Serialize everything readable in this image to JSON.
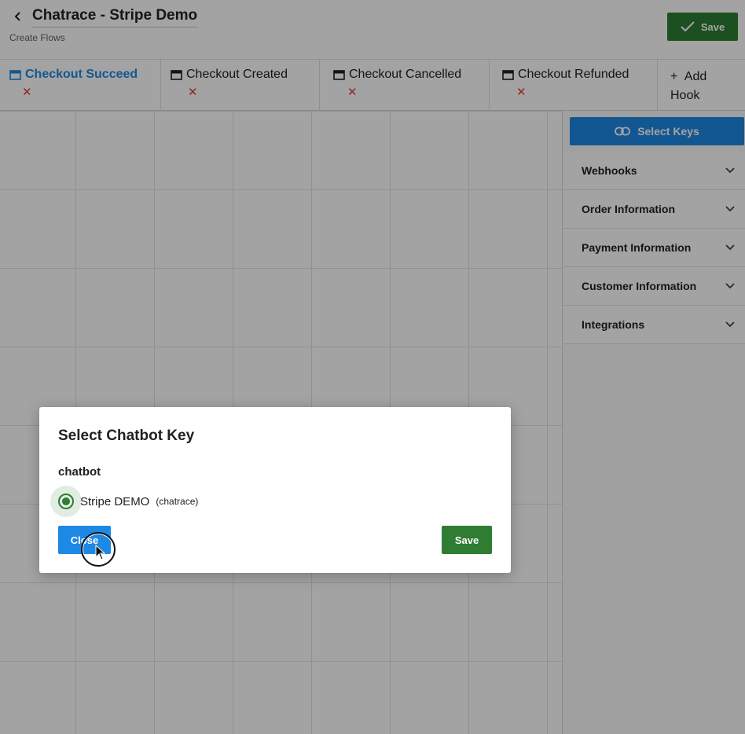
{
  "header": {
    "title": "Chatrace - Stripe Demo",
    "subtitle": "Create Flows",
    "save_label": "Save",
    "back_icon": "chevron-left-icon",
    "save_icon": "check-icon"
  },
  "tabs": [
    {
      "label": "Checkout Succeed",
      "active": true,
      "close": "✕"
    },
    {
      "label": "Checkout Created",
      "active": false,
      "close": "✕"
    },
    {
      "label": "Checkout Cancelled",
      "active": false,
      "close": "✕"
    },
    {
      "label": "Checkout Refunded",
      "active": false,
      "close": "✕"
    }
  ],
  "add_hook": {
    "plus": "+",
    "line1": "Add",
    "line2": "Hook"
  },
  "panel": {
    "select_keys_label": "Select Keys",
    "select_keys_icon": "link-icon",
    "accordion": [
      {
        "label": "Webhooks"
      },
      {
        "label": "Order Information"
      },
      {
        "label": "Payment Information"
      },
      {
        "label": "Customer Information"
      },
      {
        "label": "Integrations"
      }
    ]
  },
  "modal": {
    "title": "Select Chatbot Key",
    "group_label": "chatbot",
    "option_label": "Stripe DEMO",
    "option_sub": "(chatrace)",
    "option_selected": true,
    "close_label": "Close",
    "save_label": "Save"
  },
  "colors": {
    "primary_blue": "#1e88e5",
    "save_green": "#2e7d32",
    "close_red": "#e53935"
  }
}
